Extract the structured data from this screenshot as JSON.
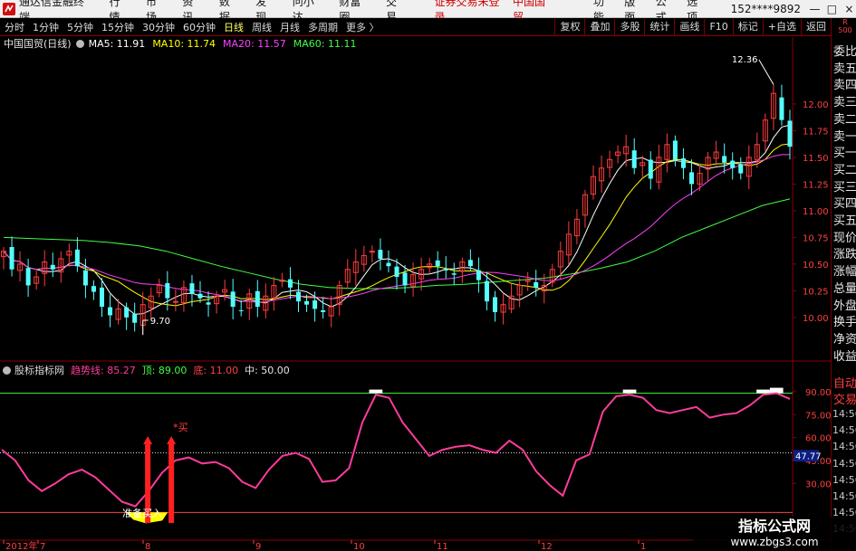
{
  "app": {
    "title": "通达信金融终端",
    "menu": [
      "行情",
      "市场",
      "资讯",
      "数据",
      "发现",
      "问小达",
      "财富圈",
      "交易"
    ],
    "notice": "证券交易未登录",
    "stock_name_top": "中国国贸",
    "right_menu": [
      "功能",
      "版面",
      "公式",
      "选项"
    ],
    "user": "152****9892",
    "win_buttons": [
      "—",
      "□",
      "×"
    ]
  },
  "toolbar": {
    "periods": [
      "分时",
      "1分钟",
      "5分钟",
      "15分钟",
      "30分钟",
      "60分钟",
      "日线",
      "周线",
      "月线",
      "多周期",
      "更多 〉"
    ],
    "active_period": "日线",
    "right_buttons": [
      "复权",
      "叠加",
      "多股",
      "统计",
      "画线",
      "F10",
      "标记",
      "+自选",
      "返回"
    ]
  },
  "side_panel": {
    "badge_top": "R",
    "badge_bottom": "500",
    "items": [
      "委比",
      "卖五",
      "卖四",
      "卖三",
      "卖二",
      "卖一",
      "买一",
      "买二",
      "买三",
      "买四",
      "买五",
      "现价",
      "涨跌",
      "涨幅",
      "总量",
      "外盘",
      "换手",
      "净资",
      "收益",
      "自动",
      "交易",
      "14:56",
      "14:56",
      "14:56",
      "14:56",
      "14:56",
      "14:56",
      "14:56",
      "14:56"
    ]
  },
  "main_chart": {
    "stock_label": "中国国贸(日线)",
    "ma": [
      {
        "label": "MA5: 11.91",
        "color": "#ffffff"
      },
      {
        "label": "MA10: 11.74",
        "color": "#ffff00"
      },
      {
        "label": "MA20: 11.57",
        "color": "#ff40ff"
      },
      {
        "label": "MA60: 11.11",
        "color": "#40ff40"
      }
    ],
    "y_ticks": [
      "12.00",
      "11.75",
      "11.50",
      "11.25",
      "11.00",
      "10.75",
      "10.50",
      "10.25",
      "10.00"
    ],
    "high_label": "12.36",
    "low_label": "9.70",
    "up_color": "#ff3c3c",
    "down_color": "#54ffff"
  },
  "indicator": {
    "name": "股标指标网",
    "trend_label": "趋势线: 85.27",
    "top_label": "顶: 89.00",
    "bottom_label": "底: 11.00",
    "mid_label": "中: 50.00",
    "y_ticks": [
      "90.00",
      "75.00",
      "60.00",
      "45.00",
      "30.00"
    ],
    "current_value": "47.77",
    "buy_label": "买",
    "ready_label": "准备买入",
    "line_color": "#ff3c9a"
  },
  "date_axis": [
    "2012年",
    "7",
    "8",
    "9",
    "10",
    "11",
    "12",
    "1"
  ],
  "watermark": {
    "title": "指标公式网",
    "url": "www.zbgs3.com"
  },
  "chart_data": {
    "type": "line",
    "title": "中国国贸(日线)",
    "price_ylim": [
      9.6,
      12.5
    ],
    "price_close": [
      10.62,
      10.45,
      10.5,
      10.3,
      10.38,
      10.52,
      10.45,
      10.55,
      10.62,
      10.48,
      10.3,
      10.24,
      10.1,
      10.02,
      10.08,
      10.0,
      9.95,
      10.12,
      10.2,
      10.3,
      10.18,
      10.15,
      10.28,
      10.22,
      10.18,
      10.12,
      10.2,
      10.26,
      10.1,
      10.06,
      10.22,
      10.1,
      10.2,
      10.3,
      10.35,
      10.28,
      10.15,
      10.12,
      10.08,
      10.05,
      10.1,
      10.3,
      10.45,
      10.52,
      10.58,
      10.62,
      10.55,
      10.48,
      10.38,
      10.3,
      10.4,
      10.45,
      10.5,
      10.48,
      10.44,
      10.4,
      10.52,
      10.48,
      10.35,
      10.15,
      10.05,
      10.12,
      10.2,
      10.3,
      10.35,
      10.28,
      10.3,
      10.45,
      10.62,
      10.78,
      10.92,
      11.15,
      11.32,
      11.4,
      11.48,
      11.55,
      11.6,
      11.4,
      11.45,
      11.3,
      11.5,
      11.62,
      11.48,
      11.4,
      11.25,
      11.35,
      11.5,
      11.55,
      11.45,
      11.4,
      11.35,
      11.5,
      11.62,
      11.85,
      12.1,
      11.85,
      11.6
    ],
    "ma60": [
      10.75,
      10.74,
      10.73,
      10.72,
      10.7,
      10.67,
      10.62,
      10.55,
      10.48,
      10.42,
      10.36,
      10.31,
      10.28,
      10.27,
      10.27,
      10.28,
      10.3,
      10.31,
      10.33,
      10.35,
      10.37,
      10.41,
      10.46,
      10.52,
      10.62,
      10.75,
      10.85,
      10.95,
      11.05,
      11.11
    ],
    "indicator": [
      52,
      45,
      32,
      25,
      30,
      36,
      39,
      34,
      26,
      18,
      15,
      25,
      37,
      45,
      47,
      43,
      44,
      40,
      31,
      27,
      39,
      48,
      50,
      46,
      31,
      32,
      40,
      70,
      88,
      86,
      70,
      59,
      48,
      52,
      54,
      55,
      52,
      50,
      58,
      52,
      38,
      29,
      22,
      45,
      49,
      77,
      87,
      88,
      86,
      78,
      76,
      78,
      80,
      73,
      75,
      76,
      81,
      88,
      89,
      85.27
    ],
    "indicator_ylim": [
      0,
      100
    ],
    "reference_lines": {
      "top": 89.0,
      "bottom": 11.0,
      "mid": 50.0
    }
  }
}
